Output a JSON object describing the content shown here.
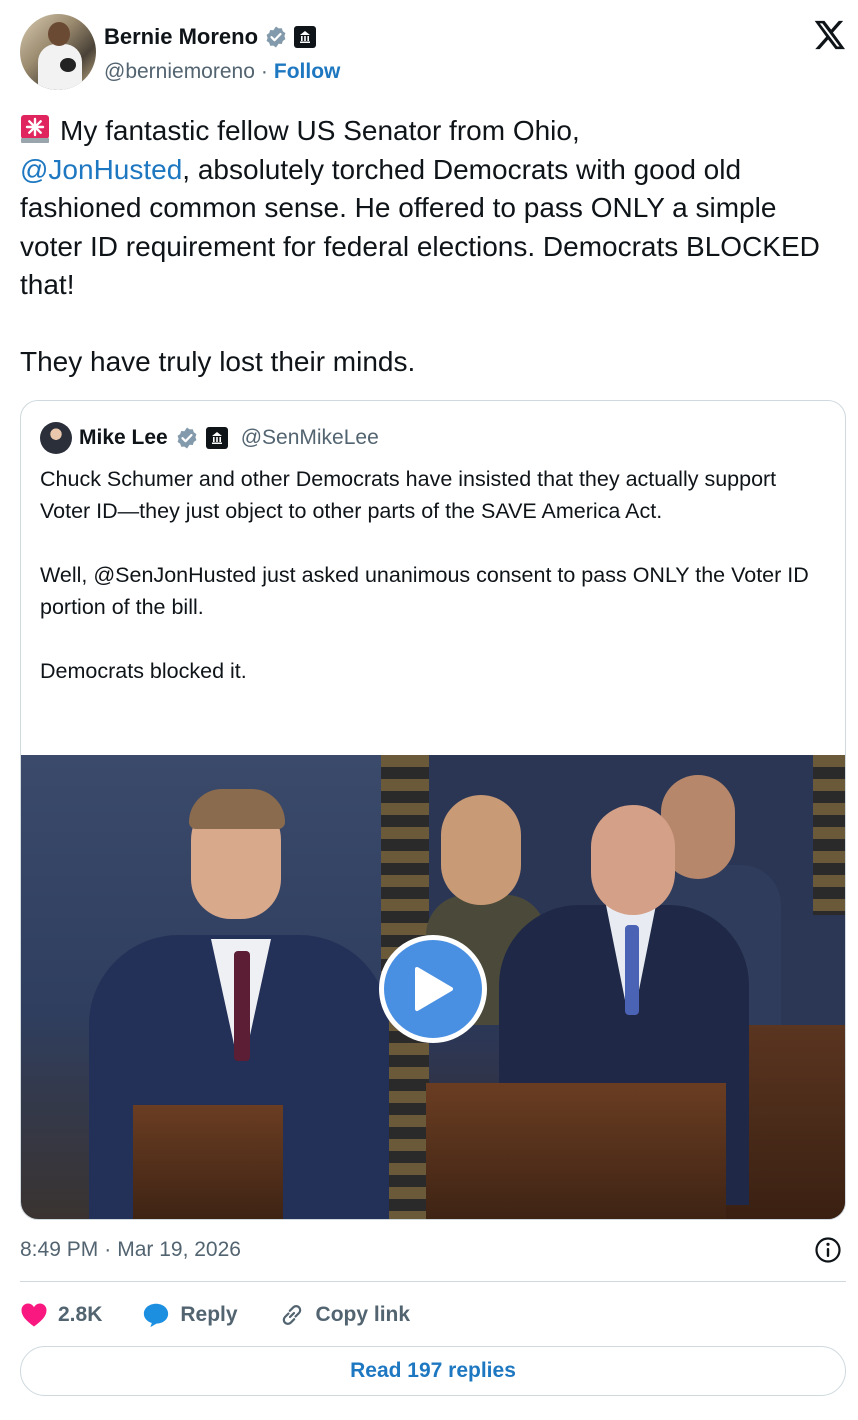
{
  "author": {
    "display_name": "Bernie Moreno",
    "handle": "@berniemoreno",
    "separator": "·",
    "follow_label": "Follow"
  },
  "tweet": {
    "line1": "My fantastic fellow US Senator from Ohio,",
    "mention": "@JonHusted",
    "rest": ", absolutely torched Democrats with good old fashioned common sense. He offered to pass ONLY a simple voter ID requirement for federal elections. Democrats BLOCKED that!\n\nThey have truly lost their minds."
  },
  "quote": {
    "display_name": "Mike Lee",
    "handle": "@SenMikeLee",
    "text": "Chuck Schumer and other Democrats have insisted that they actually support Voter ID—they just object to other parts of the SAVE America Act.\n\nWell, @SenJonHusted just asked unanimous consent to pass ONLY the Voter ID portion of the bill.\n\nDemocrats blocked it."
  },
  "meta": {
    "time": "8:49 PM",
    "separator": "·",
    "date": "Mar 19, 2026"
  },
  "actions": {
    "likes": "2.8K",
    "reply_label": "Reply",
    "copy_link_label": "Copy link"
  },
  "read_replies_label": "Read 197 replies",
  "icons": {
    "verified": "verified-badge-icon",
    "gov": "government-building-icon",
    "x_logo": "x-logo-icon",
    "info": "info-icon",
    "heart": "heart-icon",
    "reply": "speech-bubble-icon",
    "link": "link-icon",
    "play": "play-icon",
    "siren": "police-light-icon"
  },
  "colors": {
    "link_blue": "#1d78c1",
    "secondary_text": "#536471",
    "heart_pink": "#f91880",
    "verified_gray": "#829aab",
    "play_blue": "#4a90e2"
  }
}
